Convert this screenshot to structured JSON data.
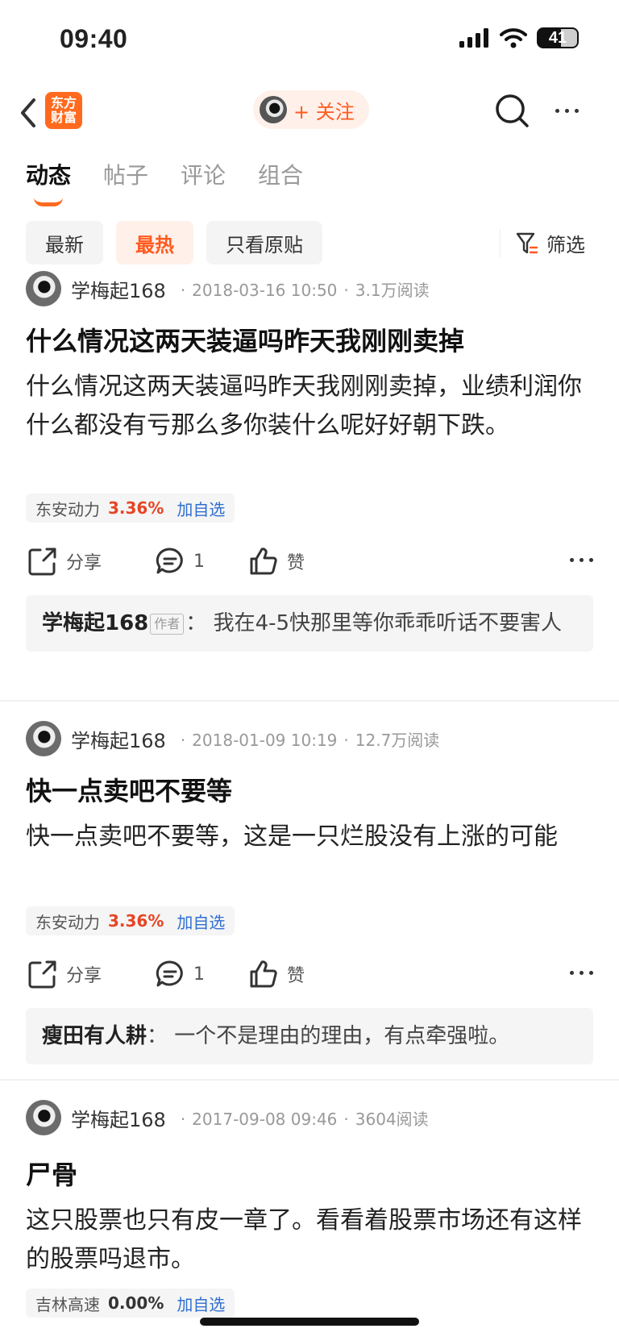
{
  "status_bar": {
    "time": "09:40",
    "battery": "41"
  },
  "nav": {
    "logo_text": "东方财富",
    "follow_label": "+ 关注"
  },
  "tabs": [
    {
      "label": "动态"
    },
    {
      "label": "帖子"
    },
    {
      "label": "评论"
    },
    {
      "label": "组合"
    }
  ],
  "filters": {
    "chips": [
      {
        "label": "最新"
      },
      {
        "label": "最热"
      },
      {
        "label": "只看原贴"
      }
    ],
    "filter_label": "筛选"
  },
  "posts": [
    {
      "author": "学梅起168",
      "date": "2018-03-16 10:50",
      "reads": "3.1万阅读",
      "title": "什么情况这两天装逼吗昨天我刚刚卖掉",
      "body": "什么情况这两天装逼吗昨天我刚刚卖掉，业绩利润你什么都没有亏那么多你装什么呢好好朝下跌。",
      "stock": {
        "name": "东安动力",
        "change": "3.36%",
        "add_label": "加自选"
      },
      "actions": {
        "share": "分享",
        "comments": "1",
        "like": "赞"
      },
      "comment": {
        "name": "学梅起168",
        "badge": "作者",
        "colon": "：",
        "text": "我在4-5快那里等你乖乖听话不要害人"
      }
    },
    {
      "author": "学梅起168",
      "date": "2018-01-09 10:19",
      "reads": "12.7万阅读",
      "title": "快一点卖吧不要等",
      "body": "快一点卖吧不要等，这是一只烂股没有上涨的可能",
      "stock": {
        "name": "东安动力",
        "change": "3.36%",
        "add_label": "加自选"
      },
      "actions": {
        "share": "分享",
        "comments": "1",
        "like": "赞"
      },
      "comment": {
        "name": "瘦田有人耕",
        "colon": "：",
        "text": "一个不是理由的理由，有点牵强啦。"
      }
    },
    {
      "author": "学梅起168",
      "date": "2017-09-08 09:46",
      "reads": "3604阅读",
      "title": "尸骨",
      "body": "这只股票也只有皮一章了。看看着股票市场还有这样的股票吗退市。",
      "stock": {
        "name": "吉林高速",
        "change": "0.00%",
        "add_label": "加自选"
      }
    }
  ],
  "meta_separator": "·",
  "colors": {
    "accent": "#ff5a1f",
    "up": "#e64525",
    "link": "#2f6fd1"
  }
}
